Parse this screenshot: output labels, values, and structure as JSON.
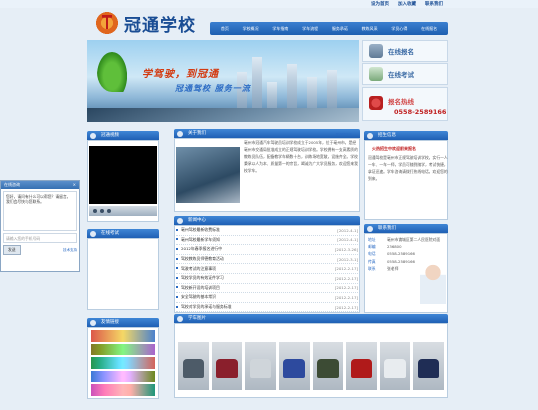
{
  "header": {
    "toplinks": [
      "设为首页",
      "加入收藏",
      "联系我们"
    ],
    "logo": "冠通学校",
    "nav": [
      "首页",
      "学校概况",
      "学车指南",
      "学车流程",
      "服务承诺",
      "教练风采",
      "学员心得",
      "在线报名"
    ]
  },
  "banner": {
    "slogan1": "学驾驶，到冠通",
    "slogan2": "冠通驾校 服务一流"
  },
  "right": {
    "signup": "在线报名",
    "exam": "在线考试",
    "hotline_label": "报名热线",
    "hotline": "0558-2589166",
    "notice_head": "招生信息",
    "notice_title": "火热招生中欢迎前来报名",
    "notice_text": "冠通驾校是亳州市正规驾驶培训学校，实行一人一车、一车一师，学员可随到随学，考试快捷，拿证迅速。学车咨询请拨打热线电话，欢迎您的到来。",
    "contact_head": "联系我们",
    "contact": [
      {
        "k": "地址",
        "v": "亳州市谯城区第二人民医院对面"
      },
      {
        "k": "邮编",
        "v": "236800"
      },
      {
        "k": "电话",
        "v": "0558-2589166"
      },
      {
        "k": "传真",
        "v": "0558-2589166"
      },
      {
        "k": "联系",
        "v": "张老师"
      }
    ]
  },
  "left": {
    "video_head": "冠通视频",
    "exam_head": "在线考试",
    "links_head": "友情链接"
  },
  "intro": {
    "head": "关于我们",
    "more": "more>>",
    "text": "亳州市冠通汽车驾驶员培训学校成立于2005年，位于亳州市，是经亳州市交通局批准成立的正规驾驶培训学校。学校拥有一支高素质的教练员队伍，配备教学车辆数十台，训练场地宽敞，设施齐全。学校秉承以人为本、质量第一的宗旨，竭诚为广大学员服务，欢迎您来我校学车。"
  },
  "news": {
    "head": "新闻中心",
    "items": [
      {
        "t": "亳州驾校最新收费标准",
        "d": "[2012-4-1]"
      },
      {
        "t": "亳州驾校最新学车须知",
        "d": "[2012-4-1]"
      },
      {
        "t": "2012年春季报名进行中",
        "d": "[2012-3-26]"
      },
      {
        "t": "驾校教练员师德教育活动",
        "d": "[2012-3-1]"
      },
      {
        "t": "驾驶考试的注意事项",
        "d": "[2012-2-17]"
      },
      {
        "t": "驾校学员的有效证件学习",
        "d": "[2012-2-17]"
      },
      {
        "t": "驾校新开设的培训项目",
        "d": "[2012-2-17]"
      },
      {
        "t": "安全驾驶的基本常识",
        "d": "[2012-2-17]"
      },
      {
        "t": "驾校对学员的承诺与服务标准",
        "d": "[2012-2-17]"
      }
    ]
  },
  "gallery_head": "学车图片",
  "chat": {
    "title": "在线咨询",
    "close": "×",
    "msg": "您好，请问有什么可以帮您？请留言，我们会尽快与您联系。",
    "placeholder": "请输入您的手机号码",
    "send": "发送",
    "footer": "技术支持"
  }
}
